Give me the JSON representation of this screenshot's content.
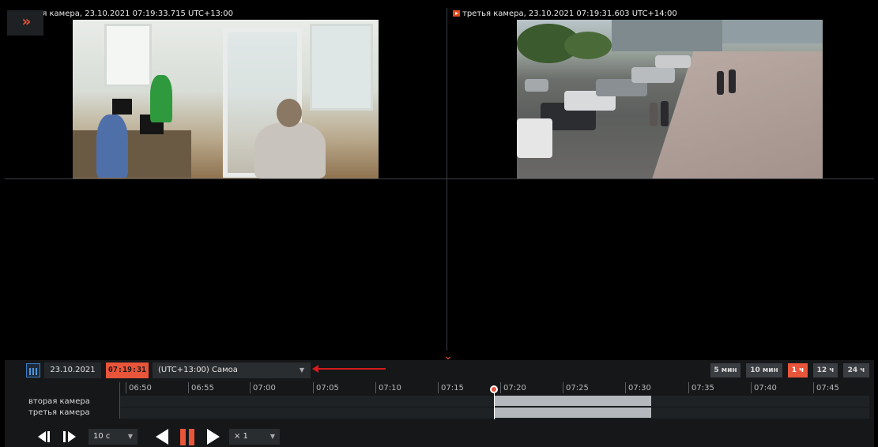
{
  "cameras": [
    {
      "caption": "вторая камера, 23.10.2021 07:19:33.715 UTC+13:00",
      "name": "вторая камера"
    },
    {
      "caption": "третья камера, 23.10.2021 07:19:31.603 UTC+14:00",
      "name": "третья камера"
    }
  ],
  "grid_toggle": {
    "label": "»",
    "icon": "double-chevron-right-icon"
  },
  "collapse": {
    "icon": "chevron-down-icon",
    "glyph": "⌄"
  },
  "timeline": {
    "date": "23.10.2021",
    "time": "07:19:31",
    "timezone": "(UTC+13:00) Самоа",
    "scales": [
      "5 мин",
      "10 мин",
      "1 ч",
      "12 ч",
      "24 ч"
    ],
    "active_scale": "1 ч",
    "ticks": [
      "06:50",
      "06:55",
      "07:00",
      "07:05",
      "07:10",
      "07:15",
      "07:20",
      "07:25",
      "07:30",
      "07:35",
      "07:40",
      "07:45"
    ],
    "tracks": [
      {
        "label": "вторая камера",
        "recording": [
          "07:19:31",
          "07:32"
        ]
      },
      {
        "label": "третья камера",
        "recording": [
          "07:19:31",
          "07:32"
        ]
      }
    ]
  },
  "playback": {
    "step_value": "10 с",
    "speed_value": "× 1"
  },
  "colors": {
    "accent": "#e8553a",
    "annotation_arrow": "#d61b1b"
  }
}
